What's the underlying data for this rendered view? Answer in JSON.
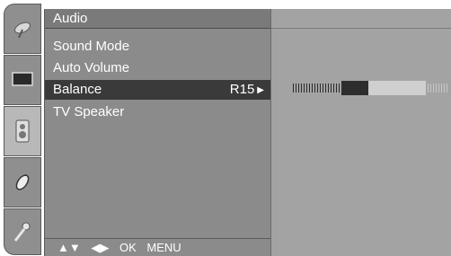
{
  "menu": {
    "title": "Audio",
    "items": [
      {
        "label": "Sound Mode",
        "value": "",
        "selected": false
      },
      {
        "label": "Auto Volume",
        "value": "",
        "selected": false
      },
      {
        "label": "Balance",
        "value": "R15",
        "selected": true
      },
      {
        "label": "TV Speaker",
        "value": "",
        "selected": false
      }
    ],
    "footer": {
      "nav_updown": "▲▼",
      "nav_leftright": "◀▶",
      "ok": "OK",
      "menu": "MENU"
    }
  },
  "sidebar_icons": [
    "antenna-icon",
    "picture-icon",
    "speaker-icon",
    "time-icon",
    "setup-icon"
  ],
  "balance": {
    "value": "R15"
  },
  "colors": {
    "panel": "#8b8b8b",
    "selected": "#3a3a3a",
    "subpanel": "#a3a3a3"
  }
}
